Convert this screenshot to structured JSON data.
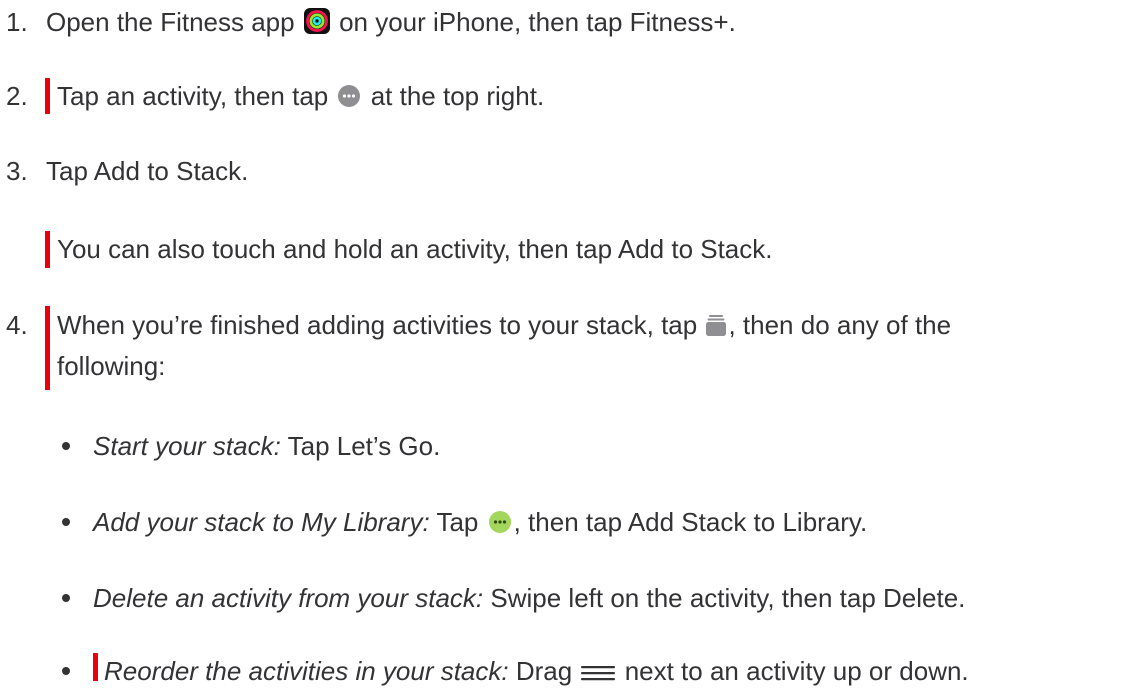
{
  "steps": [
    {
      "num": "1.",
      "before": "Open the Fitness app",
      "icon": "fitness-app-icon",
      "after": "on your iPhone, then tap Fitness+."
    },
    {
      "num": "2.",
      "before": "Tap an activity, then tap",
      "icon": "more-options-icon",
      "after": "at the top right."
    },
    {
      "num": "3.",
      "text": "Tap Add to Stack."
    },
    {
      "note": "You can also touch and hold an activity, then tap Add to Stack."
    },
    {
      "num": "4.",
      "line1_before": "When you’re finished adding activities to your stack, tap",
      "icon": "stack-icon",
      "line1_after": ", then do any of the",
      "line2": "following:"
    }
  ],
  "bullets": [
    {
      "term": "Start your stack:",
      "text": "Tap Let’s Go."
    },
    {
      "term": "Add your stack to My Library:",
      "before": "Tap",
      "icon": "more-options-green-icon",
      "after": ", then tap Add Stack to Library."
    },
    {
      "term": "Delete an activity from your stack:",
      "text": "Swipe left on the activity, then tap Delete."
    },
    {
      "term": "Reorder the activities in your stack:",
      "before": "Drag",
      "icon": "reorder-handle-icon",
      "after": "next to an activity up or down."
    }
  ],
  "colors": {
    "text": "#333336",
    "change_bar": "#e8000d",
    "more_icon_gray": "#8e8e93",
    "more_icon_green": "#a3d65c"
  }
}
